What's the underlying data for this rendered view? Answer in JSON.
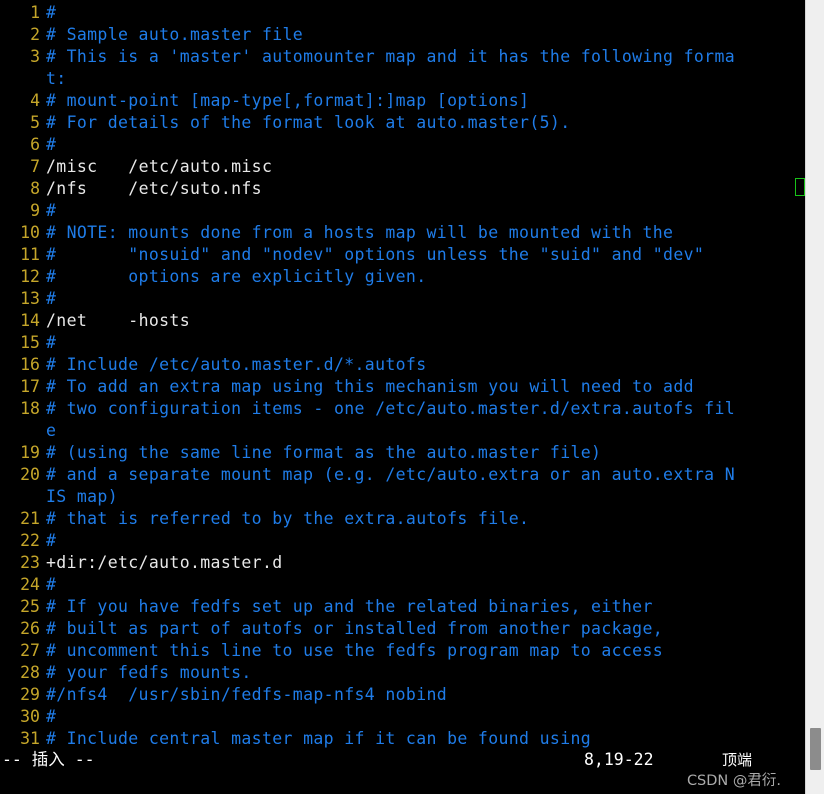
{
  "app": {
    "editor": "vim",
    "filename": "auto.master",
    "colors": {
      "background": "#000000",
      "line_number": "#c5a62a",
      "comment": "#1f7ce8",
      "normal_text": "#e8e8e8",
      "cursor_border": "#19c219",
      "status_text": "#ffffff",
      "scrollbar_track": "#efefef",
      "scrollbar_thumb": "#8c8c8c",
      "watermark": "#b9b9b9"
    }
  },
  "buffer": {
    "lines": [
      {
        "num": "1",
        "text": "#",
        "style": "comment",
        "wrap": ""
      },
      {
        "num": "2",
        "text": "# Sample auto.master file",
        "style": "comment",
        "wrap": ""
      },
      {
        "num": "3",
        "text": "# This is a 'master' automounter map and it has the following forma",
        "style": "comment",
        "wrap": "t:"
      },
      {
        "num": "4",
        "text": "# mount-point [map-type[,format]:]map [options]",
        "style": "comment",
        "wrap": ""
      },
      {
        "num": "5",
        "text": "# For details of the format look at auto.master(5).",
        "style": "comment",
        "wrap": ""
      },
      {
        "num": "6",
        "text": "#",
        "style": "comment",
        "wrap": ""
      },
      {
        "num": "7",
        "text": "/misc\t/etc/auto.misc",
        "style": "plain",
        "wrap": ""
      },
      {
        "num": "8",
        "text": "/nfs\t/etc/suto.nfs",
        "style": "plain",
        "wrap": "",
        "cursor_at_end": true
      },
      {
        "num": "9",
        "text": "#",
        "style": "comment",
        "wrap": ""
      },
      {
        "num": "10",
        "text": "# NOTE: mounts done from a hosts map will be mounted with the",
        "style": "comment",
        "wrap": ""
      },
      {
        "num": "11",
        "text": "#       \"nosuid\" and \"nodev\" options unless the \"suid\" and \"dev\"",
        "style": "comment",
        "wrap": ""
      },
      {
        "num": "12",
        "text": "#       options are explicitly given.",
        "style": "comment",
        "wrap": ""
      },
      {
        "num": "13",
        "text": "#",
        "style": "comment",
        "wrap": ""
      },
      {
        "num": "14",
        "text": "/net\t-hosts",
        "style": "plain",
        "wrap": ""
      },
      {
        "num": "15",
        "text": "#",
        "style": "comment",
        "wrap": ""
      },
      {
        "num": "16",
        "text": "# Include /etc/auto.master.d/*.autofs",
        "style": "comment",
        "wrap": ""
      },
      {
        "num": "17",
        "text": "# To add an extra map using this mechanism you will need to add",
        "style": "comment",
        "wrap": ""
      },
      {
        "num": "18",
        "text": "# two configuration items - one /etc/auto.master.d/extra.autofs fil",
        "style": "comment",
        "wrap": "e"
      },
      {
        "num": "19",
        "text": "# (using the same line format as the auto.master file)",
        "style": "comment",
        "wrap": ""
      },
      {
        "num": "20",
        "text": "# and a separate mount map (e.g. /etc/auto.extra or an auto.extra N",
        "style": "comment",
        "wrap": "IS map)"
      },
      {
        "num": "21",
        "text": "# that is referred to by the extra.autofs file.",
        "style": "comment",
        "wrap": ""
      },
      {
        "num": "22",
        "text": "#",
        "style": "comment",
        "wrap": ""
      },
      {
        "num": "23",
        "text": "+dir:/etc/auto.master.d",
        "style": "plain",
        "wrap": ""
      },
      {
        "num": "24",
        "text": "#",
        "style": "comment",
        "wrap": ""
      },
      {
        "num": "25",
        "text": "# If you have fedfs set up and the related binaries, either",
        "style": "comment",
        "wrap": ""
      },
      {
        "num": "26",
        "text": "# built as part of autofs or installed from another package,",
        "style": "comment",
        "wrap": ""
      },
      {
        "num": "27",
        "text": "# uncomment this line to use the fedfs program map to access",
        "style": "comment",
        "wrap": ""
      },
      {
        "num": "28",
        "text": "# your fedfs mounts.",
        "style": "comment",
        "wrap": ""
      },
      {
        "num": "29",
        "text": "#/nfs4  /usr/sbin/fedfs-map-nfs4 nobind",
        "style": "comment",
        "wrap": ""
      },
      {
        "num": "30",
        "text": "#",
        "style": "comment",
        "wrap": ""
      },
      {
        "num": "31",
        "text": "# Include central master map if it can be found using",
        "style": "comment",
        "wrap": ""
      }
    ]
  },
  "statusline": {
    "mode": "-- 插入 --",
    "position": "8,19-22",
    "location": "顶端"
  },
  "scrollbar": {
    "thumb_label": "vertical-scroll-thumb"
  },
  "watermark": {
    "text": "CSDN @君衍."
  }
}
